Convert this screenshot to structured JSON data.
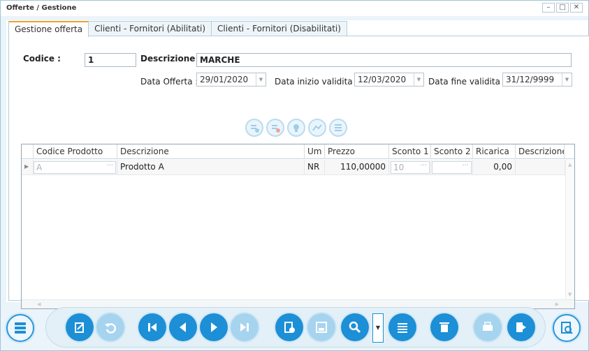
{
  "window": {
    "title": "Offerte / Gestione",
    "controls": [
      "minimize",
      "maximize",
      "close"
    ]
  },
  "tabs": [
    {
      "label": "Gestione offerta",
      "active": true
    },
    {
      "label": "Clienti - Fornitori (Abilitati)",
      "active": false
    },
    {
      "label": "Clienti - Fornitori (Disabilitati)",
      "active": false
    }
  ],
  "form": {
    "codice_label": "Codice :",
    "codice_value": "1",
    "descrizione_label": "Descrizione :",
    "descrizione_value": "MARCHE",
    "data_offerta_label": "Data Offerta :",
    "data_offerta_value": "29/01/2020",
    "data_inizio_label": "Data inizio validita ' :",
    "data_inizio_value": "12/03/2020",
    "data_fine_label": "Data fine validita ' :",
    "data_fine_value": "31/12/9999"
  },
  "grid_toolbar_icons": [
    "add-row-icon",
    "delete-row-icon",
    "bulb-icon",
    "chart-icon",
    "list-icon"
  ],
  "grid": {
    "columns": [
      "Codice Prodotto",
      "Descrizione",
      "Um",
      "Prezzo",
      "Sconto 1",
      "Sconto 2",
      "Ricarica",
      "Descrizione"
    ],
    "rows": [
      {
        "codice": "A",
        "descrizione": "Prodotto A",
        "um": "NR",
        "prezzo": "110,00000",
        "sconto1": "10",
        "sconto2": "",
        "ricarica": "0,00",
        "descrizione2": ""
      }
    ]
  },
  "bottom_buttons": [
    "menu-icon",
    "edit-icon",
    "undo-icon",
    "first-icon",
    "prev-icon",
    "next-icon",
    "last-icon",
    "new-icon",
    "save-icon",
    "search-icon",
    "list-icon",
    "delete-icon",
    "print-icon",
    "exit-icon",
    "preview-icon"
  ],
  "colors": {
    "accent": "#1c8fd6",
    "disabled": "#a6d4ef",
    "tab_highlight": "#e8a22c"
  }
}
